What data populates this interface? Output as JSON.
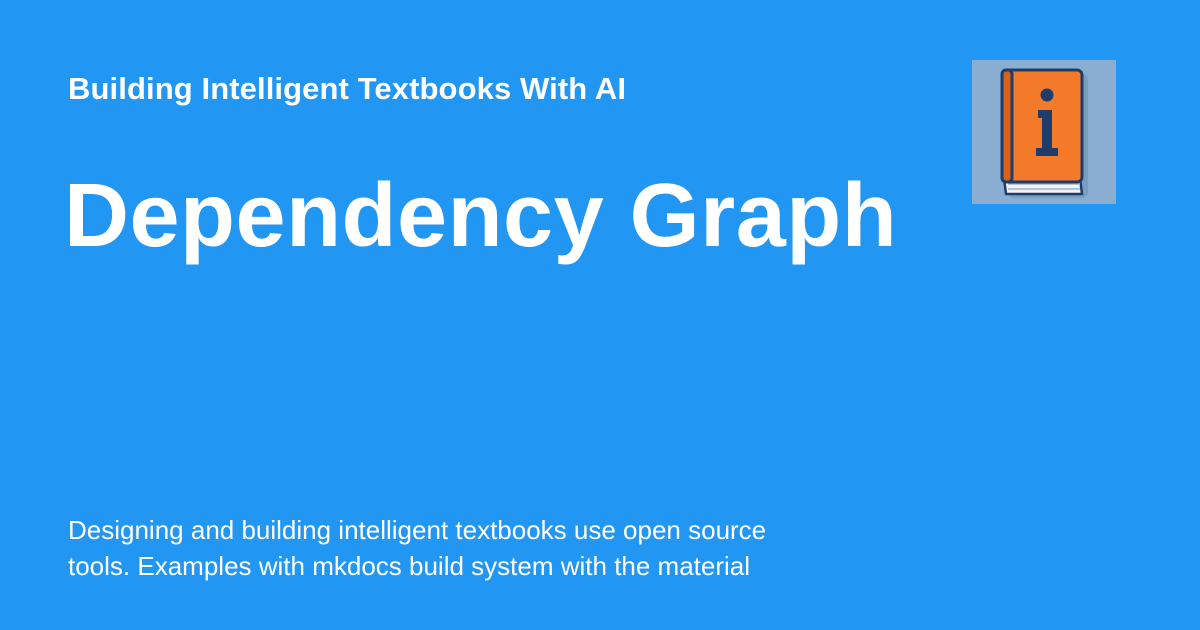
{
  "header": {
    "site_name": "Building Intelligent Textbooks With AI",
    "logo_icon": "info-book-icon"
  },
  "page": {
    "title": "Dependency Graph",
    "description": "Designing and building intelligent textbooks use open source\ntools.  Examples with mkdocs build system with the material"
  },
  "colors": {
    "background": "#2196f3",
    "text": "#ffffff",
    "logo_background": "#8aaed2",
    "book_cover": "#f47a2b",
    "book_outline": "#1f3d6b"
  }
}
